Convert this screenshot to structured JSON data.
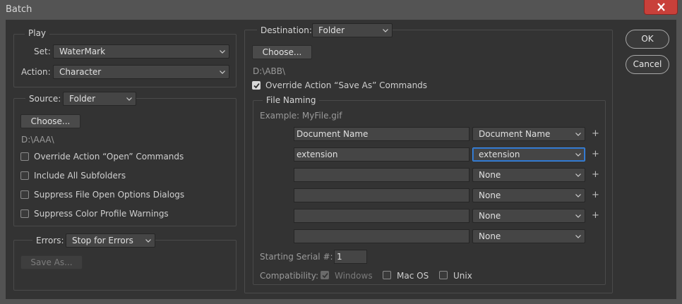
{
  "window": {
    "title": "Batch"
  },
  "buttons": {
    "ok": "OK",
    "cancel": "Cancel"
  },
  "play": {
    "legend": "Play",
    "set_label": "Set:",
    "set_value": "WaterMark",
    "action_label": "Action:",
    "action_value": "Character"
  },
  "source": {
    "label": "Source:",
    "value": "Folder",
    "choose": "Choose...",
    "path": "D:\\AAA\\",
    "options": [
      {
        "label": "Override Action “Open” Commands",
        "checked": false
      },
      {
        "label": "Include All Subfolders",
        "checked": false
      },
      {
        "label": "Suppress File Open Options Dialogs",
        "checked": false
      },
      {
        "label": "Suppress Color Profile Warnings",
        "checked": false
      }
    ]
  },
  "errors": {
    "label": "Errors:",
    "value": "Stop for Errors",
    "save_as": "Save As..."
  },
  "destination": {
    "label": "Destination:",
    "value": "Folder",
    "choose": "Choose...",
    "path": "D:\\ABB\\",
    "override_label": "Override Action “Save As” Commands",
    "override_checked": true
  },
  "file_naming": {
    "legend": "File Naming",
    "example": "Example: MyFile.gif",
    "rows": [
      {
        "text": "Document Name",
        "select": "Document Name"
      },
      {
        "text": "extension",
        "select": "extension"
      },
      {
        "text": "",
        "select": "None"
      },
      {
        "text": "",
        "select": "None"
      },
      {
        "text": "",
        "select": "None"
      },
      {
        "text": "",
        "select": "None"
      }
    ],
    "plus": "+",
    "serial_label": "Starting Serial #:",
    "serial_value": "1",
    "compat_label": "Compatibility:",
    "compat": [
      {
        "label": "Windows",
        "checked": true,
        "disabled": true
      },
      {
        "label": "Mac OS",
        "checked": false,
        "disabled": false
      },
      {
        "label": "Unix",
        "checked": false,
        "disabled": false
      }
    ]
  }
}
